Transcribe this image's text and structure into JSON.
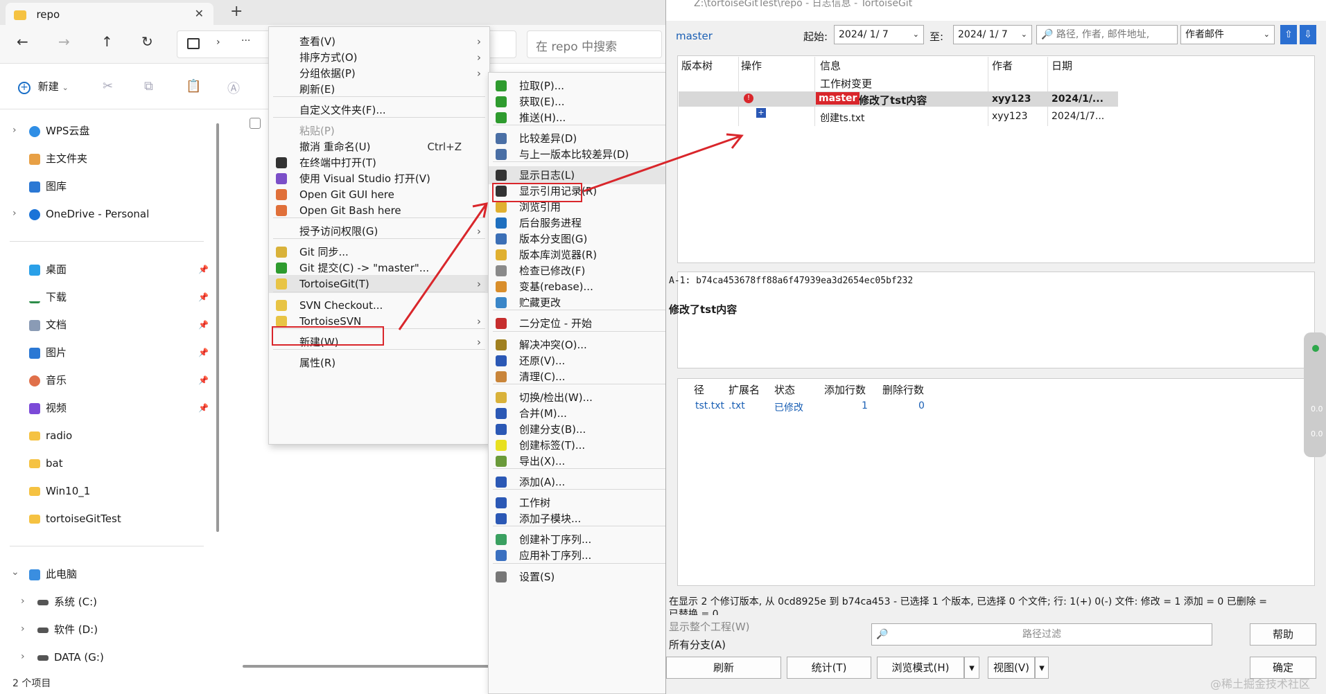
{
  "explorer": {
    "tab_title": "repo",
    "search_placeholder": "在 repo 中搜索",
    "new_label": "新建",
    "status": "2 个项目",
    "sidebar": [
      {
        "label": "WPS云盘",
        "icon": "cloud-icon"
      },
      {
        "label": "主文件夹",
        "icon": "home-icon"
      },
      {
        "label": "图库",
        "icon": "gallery-icon"
      },
      {
        "label": "OneDrive - Personal",
        "icon": "cloud-icon"
      },
      {
        "label": "桌面",
        "icon": "desktop-icon"
      },
      {
        "label": "下载",
        "icon": "download-icon"
      },
      {
        "label": "文档",
        "icon": "document-icon"
      },
      {
        "label": "图片",
        "icon": "picture-icon"
      },
      {
        "label": "音乐",
        "icon": "music-icon"
      },
      {
        "label": "视频",
        "icon": "video-icon"
      },
      {
        "label": "radio",
        "icon": "folder-icon"
      },
      {
        "label": "bat",
        "icon": "folder-icon"
      },
      {
        "label": "Win10_1",
        "icon": "folder-icon"
      },
      {
        "label": "tortoiseGitTest",
        "icon": "folder-icon"
      },
      {
        "label": "此电脑",
        "icon": "pc-icon"
      },
      {
        "label": "系统 (C:)",
        "icon": "drive-icon"
      },
      {
        "label": "软件 (D:)",
        "icon": "drive-icon"
      },
      {
        "label": "DATA (G:)",
        "icon": "drive-icon"
      }
    ]
  },
  "context_menu": [
    {
      "label": "查看(V)",
      "arrow": "›"
    },
    {
      "label": "排序方式(O)",
      "arrow": "›"
    },
    {
      "label": "分组依据(P)",
      "arrow": "›"
    },
    {
      "label": "刷新(E)"
    },
    {
      "label": "自定义文件夹(F)..."
    },
    {
      "label": "粘贴(P)"
    },
    {
      "label": "撤消 重命名(U)",
      "shortcut": "Ctrl+Z"
    },
    {
      "label": "在终端中打开(T)"
    },
    {
      "label": "使用 Visual Studio 打开(V)"
    },
    {
      "label": "Open Git GUI here"
    },
    {
      "label": "Open Git Bash here"
    },
    {
      "label": "授予访问权限(G)",
      "arrow": "›"
    },
    {
      "label": "Git 同步..."
    },
    {
      "label": "Git 提交(C) -> \"master\"..."
    },
    {
      "label": "TortoiseGit(T)",
      "arrow": "›"
    },
    {
      "label": "SVN Checkout..."
    },
    {
      "label": "TortoiseSVN",
      "arrow": "›"
    },
    {
      "label": "新建(W)",
      "arrow": "›"
    },
    {
      "label": "属性(R)"
    }
  ],
  "tortoise_menu": [
    {
      "label": "拉取(P)...",
      "color": "#2e9b2e"
    },
    {
      "label": "获取(E)...",
      "color": "#2e9b2e"
    },
    {
      "label": "推送(H)...",
      "color": "#2e9b2e"
    },
    {
      "label": "比较差异(D)",
      "color": "#4a6fa5"
    },
    {
      "label": "与上一版本比较差异(D)",
      "color": "#4a6fa5"
    },
    {
      "label": "显示日志(L)",
      "color": "#333333"
    },
    {
      "label": "显示引用记录(R)",
      "color": "#333333"
    },
    {
      "label": "浏览引用",
      "color": "#e0b030"
    },
    {
      "label": "后台服务进程",
      "color": "#1e6fbf"
    },
    {
      "label": "版本分支图(G)",
      "color": "#3b6fb6"
    },
    {
      "label": "版本库浏览器(R)",
      "color": "#e0b030"
    },
    {
      "label": "检查已修改(F)",
      "color": "#8a8a8a"
    },
    {
      "label": "变基(rebase)...",
      "color": "#d98e2b"
    },
    {
      "label": "贮藏更改",
      "color": "#3a86c8"
    },
    {
      "label": "二分定位 - 开始",
      "color": "#c62d2d"
    },
    {
      "label": "解决冲突(O)...",
      "color": "#a08020"
    },
    {
      "label": "还原(V)...",
      "color": "#2b58b5"
    },
    {
      "label": "清理(C)...",
      "color": "#c9853a"
    },
    {
      "label": "切换/检出(W)...",
      "color": "#d9b23a"
    },
    {
      "label": "合并(M)...",
      "color": "#2b58b5"
    },
    {
      "label": "创建分支(B)...",
      "color": "#2b58b5"
    },
    {
      "label": "创建标签(T)...",
      "color": "#e8e020"
    },
    {
      "label": "导出(X)...",
      "color": "#6a9a3a"
    },
    {
      "label": "添加(A)...",
      "color": "#2b58b5"
    },
    {
      "label": "工作树",
      "color": "#2b58b5"
    },
    {
      "label": "添加子模块...",
      "color": "#2b58b5"
    },
    {
      "label": "创建补丁序列...",
      "color": "#3aa060"
    },
    {
      "label": "应用补丁序列...",
      "color": "#3a70c0"
    },
    {
      "label": "设置(S)",
      "color": "#777777"
    }
  ],
  "logwin": {
    "title": "Z:\\tortoiseGitTest\\repo - 日志信息 - TortoiseGit",
    "branch": "master",
    "from_label": "起始:",
    "from_date": "2024/ 1/ 7",
    "to_label": "至:",
    "to_date": "2024/ 1/ 7",
    "search_placeholder": "路径, 作者, 邮件地址,",
    "filter_select": "作者邮件",
    "columns": [
      "版本树",
      "操作",
      "信息",
      "作者",
      "日期"
    ],
    "rows": [
      {
        "message": "工作树变更",
        "author": "",
        "date": ""
      },
      {
        "badge": "master",
        "message": "修改了tst内容",
        "author": "xyy123",
        "date": "2024/1/..."
      },
      {
        "message": "创建ts.txt",
        "author": "xyy123",
        "date": "2024/1/7..."
      }
    ],
    "sha": "A-1: b74ca453678ff88a6f47939ea3d2654ec05bf232",
    "commit_msg": "修改了tst内容",
    "file_columns": [
      "径",
      "扩展名",
      "状态",
      "添加行数",
      "删除行数"
    ],
    "file_row": {
      "path": "tst.txt",
      "ext": ".txt",
      "status": "已修改",
      "added": "1",
      "deleted": "0"
    },
    "summary": "在显示 2 个修订版本, 从 0cd8925e 到 b74ca453 - 已选择 1 个版本, 已选择 0 个文件; 行: 1(+) 0(-) 文件: 修改 = 1 添加 = 0 已删除 =",
    "summary2": "已替换 = 0",
    "show_all": "显示整个工程(W)",
    "all_branches": "所有分支(A)",
    "path_filter": "路径过滤",
    "help": "帮助",
    "refresh": "刷新",
    "stats": "统计(T)",
    "browse": "浏览模式(H)",
    "view": "视图(V)",
    "ok": "确定",
    "side_vals": [
      "0.0",
      "0.0"
    ]
  },
  "watermark": "@稀土掘金技术社区"
}
